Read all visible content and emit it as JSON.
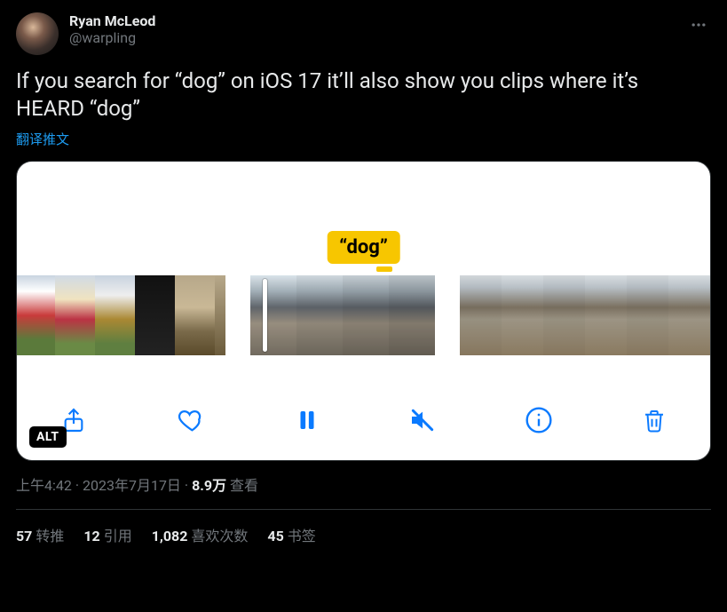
{
  "author": {
    "display_name": "Ryan McLeod",
    "handle": "@warpling"
  },
  "tweet_text": "If you search for “dog” on iOS 17 it’ll also show you clips where it’s HEARD “dog”",
  "translate_label": "翻译推文",
  "media": {
    "search_term": "“dog”",
    "alt_badge": "ALT",
    "controls": {
      "share": "share-icon",
      "like": "heart-icon",
      "pause": "pause-icon",
      "mute": "mute-icon",
      "info": "info-icon",
      "trash": "trash-icon"
    }
  },
  "meta": {
    "time": "上午4:42",
    "date": "2023年7月17日",
    "views_count": "8.9万",
    "views_label": " 查看"
  },
  "stats": {
    "retweets": {
      "count": "57",
      "label": "转推"
    },
    "quotes": {
      "count": "12",
      "label": "引用"
    },
    "likes": {
      "count": "1,082",
      "label": "喜欢次数"
    },
    "bookmarks": {
      "count": "45",
      "label": "书签"
    }
  }
}
